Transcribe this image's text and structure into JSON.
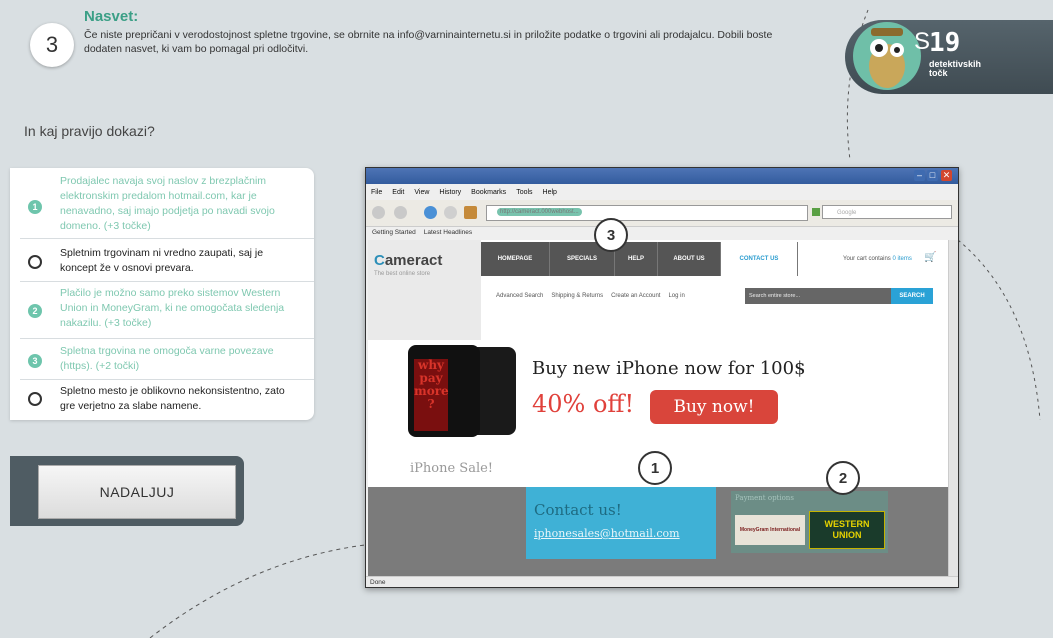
{
  "tip": {
    "step": "3",
    "title": "Nasvet:",
    "text": "Če niste prepričani v verodostojnost spletne trgovine, se obrnite na info@varninainternetu.si in priložite podatke o trgovini ali prodajalcu. Dobili boste dodaten nasvet, ki vam bo pomagal pri odločitvi."
  },
  "score": {
    "value": "19",
    "s": "S",
    "label_line1": "detektivskih",
    "label_line2": "točk"
  },
  "question": "In kaj pravijo dokazi?",
  "evidence": [
    {
      "mark": "1",
      "state": "found",
      "text": "Prodajalec navaja svoj naslov z brezplačnim elektronskim predalom hotmail.com, kar je nenavadno, saj imajo podjetja po navadi svojo domeno. (+3 točke)"
    },
    {
      "mark": "",
      "state": "open",
      "text": "Spletnim trgovinam ni vredno zaupati, saj je koncept že v osnovi prevara."
    },
    {
      "mark": "2",
      "state": "found",
      "text": "Plačilo je možno samo preko sistemov Western Union in MoneyGram, ki ne omogočata sledenja nakazilu. (+3 točke)"
    },
    {
      "mark": "3",
      "state": "found",
      "text": "Spletna trgovina ne omogoča varne povezave (https). (+2 točki)"
    },
    {
      "mark": "",
      "state": "open",
      "text": "Spletno mesto je oblikovno nekonsistentno, zato gre verjetno za slabe namene."
    }
  ],
  "continue_button": "NADALJUJ",
  "browser": {
    "menu": [
      "File",
      "Edit",
      "View",
      "History",
      "Bookmarks",
      "Tools",
      "Help"
    ],
    "url": "http://cameract.000webhost...",
    "search_placeholder": "Google",
    "bookmarks": [
      "Getting Started",
      "Latest Headlines"
    ],
    "status": "Done",
    "site": {
      "logo_prefix": "C",
      "logo_rest": "ameract",
      "tagline": "The best online store",
      "nav": [
        "HOMEPAGE",
        "SPECIALS",
        "HELP",
        "ABOUT US",
        "CONTACT US"
      ],
      "cart_text": "Your cart contains",
      "cart_count": "0 items",
      "subnav": [
        "Advanced Search",
        "Shipping & Returns",
        "Create an Account",
        "Log in"
      ],
      "search_placeholder": "Search entire store...",
      "search_button": "SEARCH",
      "phone_screen": [
        "why",
        "pay",
        "more",
        "?"
      ],
      "iphone_sale": "iPhone Sale!",
      "promo_title": "Buy new iPhone now for 100$",
      "promo_off": "40% off!",
      "buy_button": "Buy now!",
      "contact_title": "Contact us!",
      "contact_email": "iphonesales@hotmail.com",
      "payment_label": "Payment options",
      "moneygram": "MoneyGram International",
      "western_union_1": "WESTERN",
      "western_union_2": "UNION"
    },
    "callouts": [
      "1",
      "2",
      "3"
    ]
  }
}
